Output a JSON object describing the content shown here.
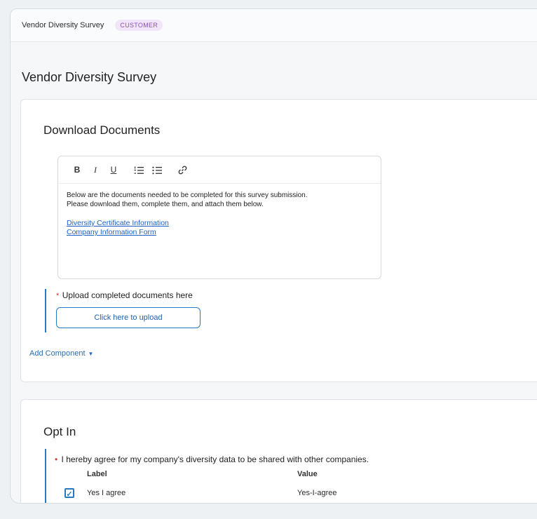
{
  "header": {
    "breadcrumb": "Vendor Diversity Survey",
    "badge": "CUSTOMER"
  },
  "page_title": "Vendor Diversity Survey",
  "download_section": {
    "title": "Download Documents",
    "toolbar": {
      "bold": "B",
      "italic": "I",
      "underline": "U",
      "numbered_list_icon": "numbered-list-icon",
      "bullet_list_icon": "bullet-list-icon",
      "link_icon": "link-icon"
    },
    "body_line1": "Below are the documents needed to be completed for this survey submission.",
    "body_line2": "Please download them, complete them, and attach them below.",
    "links": [
      "Diversity Certificate Information",
      "Company Information Form"
    ],
    "upload_required_marker": "*",
    "upload_label": "Upload completed documents here",
    "upload_button": "Click here to upload",
    "add_component": "Add Component"
  },
  "optin_section": {
    "title": "Opt In",
    "required_marker": "•",
    "question": "I hereby agree for my company's diversity data to be shared with other companies.",
    "table": {
      "headers": {
        "label": "Label",
        "value": "Value"
      },
      "rows": [
        {
          "label": "Yes I agree",
          "value": "Yes-I-agree",
          "checked": true
        }
      ]
    }
  },
  "colors": {
    "accent": "#2779c3",
    "link": "#1d5fc4",
    "badge_text": "#8a4fb5",
    "badge_bg": "#f1e6f8",
    "required": "#d13b3b"
  }
}
